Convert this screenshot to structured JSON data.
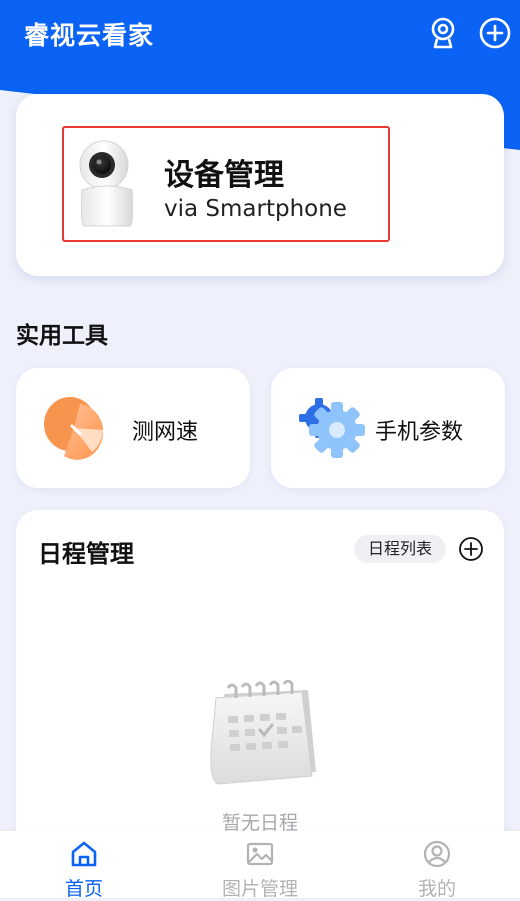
{
  "header": {
    "title": "睿视云看家",
    "camera_icon": "camera-icon",
    "add_icon": "add-icon"
  },
  "device_card": {
    "title": "设备管理",
    "subtitle": "via Smartphone",
    "icon": "camera-device-icon"
  },
  "tools": {
    "section_title": "实用工具",
    "items": [
      {
        "label": "测网速",
        "icon": "speed-test-icon"
      },
      {
        "label": "手机参数",
        "icon": "gear-icon"
      }
    ]
  },
  "schedule": {
    "title": "日程管理",
    "list_button": "日程列表",
    "add_icon": "add-icon",
    "empty_text": "暂无日程",
    "empty_icon": "calendar-icon"
  },
  "tabbar": {
    "items": [
      {
        "label": "首页",
        "icon": "home-icon",
        "active": true
      },
      {
        "label": "图片管理",
        "icon": "image-icon",
        "active": false
      },
      {
        "label": "我的",
        "icon": "user-icon",
        "active": false
      }
    ]
  },
  "colors": {
    "brand": "#0a63f5",
    "background": "#eef0fb",
    "inactive": "#b3b3b6",
    "highlight_border": "#e53935"
  }
}
